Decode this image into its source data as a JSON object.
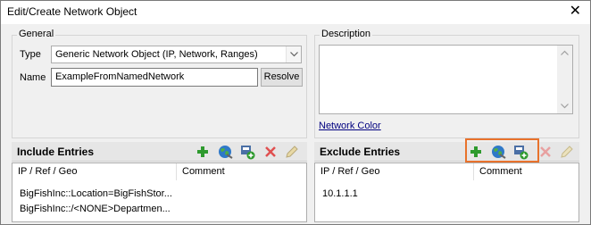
{
  "window": {
    "title": "Edit/Create Network Object",
    "close_glyph": "✕"
  },
  "general": {
    "legend": "General",
    "type_label": "Type",
    "type_value": "Generic Network Object (IP, Network, Ranges)",
    "name_label": "Name",
    "name_value": "ExampleFromNamedNetwork",
    "resolve_label": "Resolve"
  },
  "description": {
    "legend": "Description",
    "value": "",
    "network_color_link": "Network Color"
  },
  "include": {
    "title": "Include Entries",
    "columns": [
      "IP / Ref / Geo",
      "Comment"
    ],
    "rows": [
      {
        "ip": "BigFishInc::Location=BigFishStor...",
        "comment": ""
      },
      {
        "ip": "BigFishInc::/<NONE>Departmen...",
        "comment": ""
      }
    ],
    "toolbar": [
      "add-icon",
      "globe-icon",
      "add-object-icon",
      "delete-icon",
      "edit-icon"
    ]
  },
  "exclude": {
    "title": "Exclude Entries",
    "columns": [
      "IP / Ref / Geo",
      "Comment"
    ],
    "rows": [
      {
        "ip": "10.1.1.1",
        "comment": ""
      }
    ],
    "toolbar": [
      "add-icon",
      "globe-icon",
      "add-object-icon",
      "delete-icon",
      "edit-icon"
    ],
    "highlight_color": "#e8722c"
  },
  "colors": {
    "add_green": "#2e9a2e",
    "delete_red": "#e05050",
    "disabled_gray": "#b8b8b8"
  }
}
